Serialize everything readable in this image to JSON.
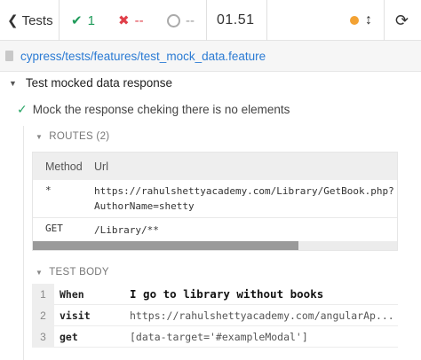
{
  "header": {
    "tests_label": "Tests",
    "passed_count": "1",
    "failed_count": "--",
    "pending_count": "--",
    "duration": "01.51",
    "status_color": "#f3a233"
  },
  "spec": {
    "file_path": "cypress/tests/features/test_mock_data.feature"
  },
  "suite": {
    "title": "Test mocked data response",
    "test_title": "Mock the response cheking there is no elements"
  },
  "routes": {
    "header": "ROUTES (2)",
    "columns": [
      "Method",
      "Url"
    ],
    "rows": [
      {
        "method": "*",
        "url": "https://rahulshettyacademy.com/Library/GetBook.php?AuthorName=shetty"
      },
      {
        "method": "GET",
        "url": "/Library/**"
      }
    ],
    "scroll_fraction": 0.73
  },
  "test_body": {
    "header": "TEST BODY",
    "commands": [
      {
        "num": "1",
        "keyword": "When",
        "arg": "I go to library without books"
      },
      {
        "num": "2",
        "keyword": "visit",
        "arg": "https://rahulshettyacademy.com/angularAp..."
      },
      {
        "num": "3",
        "keyword": "get",
        "arg": "[data-target='#exampleModal']"
      }
    ]
  },
  "icons": {
    "back": "chevron-left-icon",
    "passed": "check-icon",
    "failed": "x-icon",
    "pending": "ring-icon",
    "scroll_toggle": "up-down-arrow-icon",
    "reload": "reload-icon",
    "file": "file-icon"
  }
}
